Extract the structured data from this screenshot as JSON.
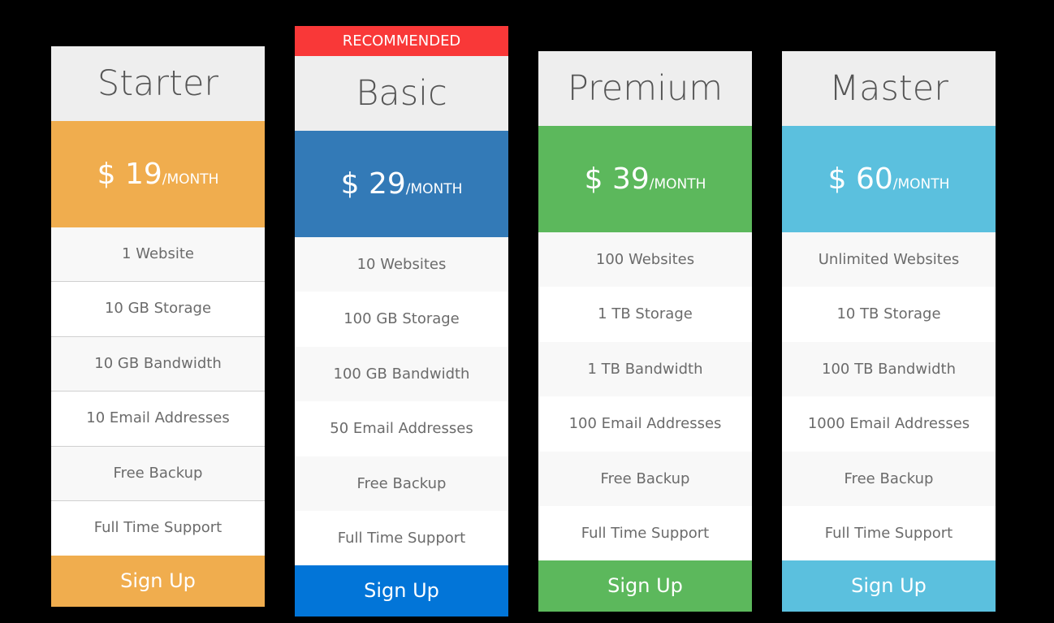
{
  "plans": [
    {
      "name": "Starter",
      "currency": "$",
      "price": "19",
      "period": "/MONTH",
      "accent": "#f0ad4e",
      "button_color": "#f0ad4e",
      "features": [
        "1 Website",
        "10 GB Storage",
        "10 GB Bandwidth",
        "10 Email Addresses",
        "Free Backup",
        "Full Time Support"
      ],
      "cta": "Sign Up"
    },
    {
      "name": "Basic",
      "badge": "RECOMMENDED",
      "badge_color": "#f93838",
      "currency": "$",
      "price": "29",
      "period": "/MONTH",
      "accent": "#337ab7",
      "button_color": "#0275d8",
      "features": [
        "10 Websites",
        "100 GB Storage",
        "100 GB Bandwidth",
        "50 Email Addresses",
        "Free Backup",
        "Full Time Support"
      ],
      "cta": "Sign Up"
    },
    {
      "name": "Premium",
      "currency": "$",
      "price": "39",
      "period": "/MONTH",
      "accent": "#5cb85c",
      "button_color": "#5cb85c",
      "features": [
        "100 Websites",
        "1 TB Storage",
        "1 TB Bandwidth",
        "100 Email Addresses",
        "Free Backup",
        "Full Time Support"
      ],
      "cta": "Sign Up"
    },
    {
      "name": "Master",
      "currency": "$",
      "price": "60",
      "period": "/MONTH",
      "accent": "#5bc0de",
      "button_color": "#5bc0de",
      "features": [
        "Unlimited Websites",
        "10 TB Storage",
        "100 TB Bandwidth",
        "1000 Email Addresses",
        "Free Backup",
        "Full Time Support"
      ],
      "cta": "Sign Up"
    }
  ]
}
